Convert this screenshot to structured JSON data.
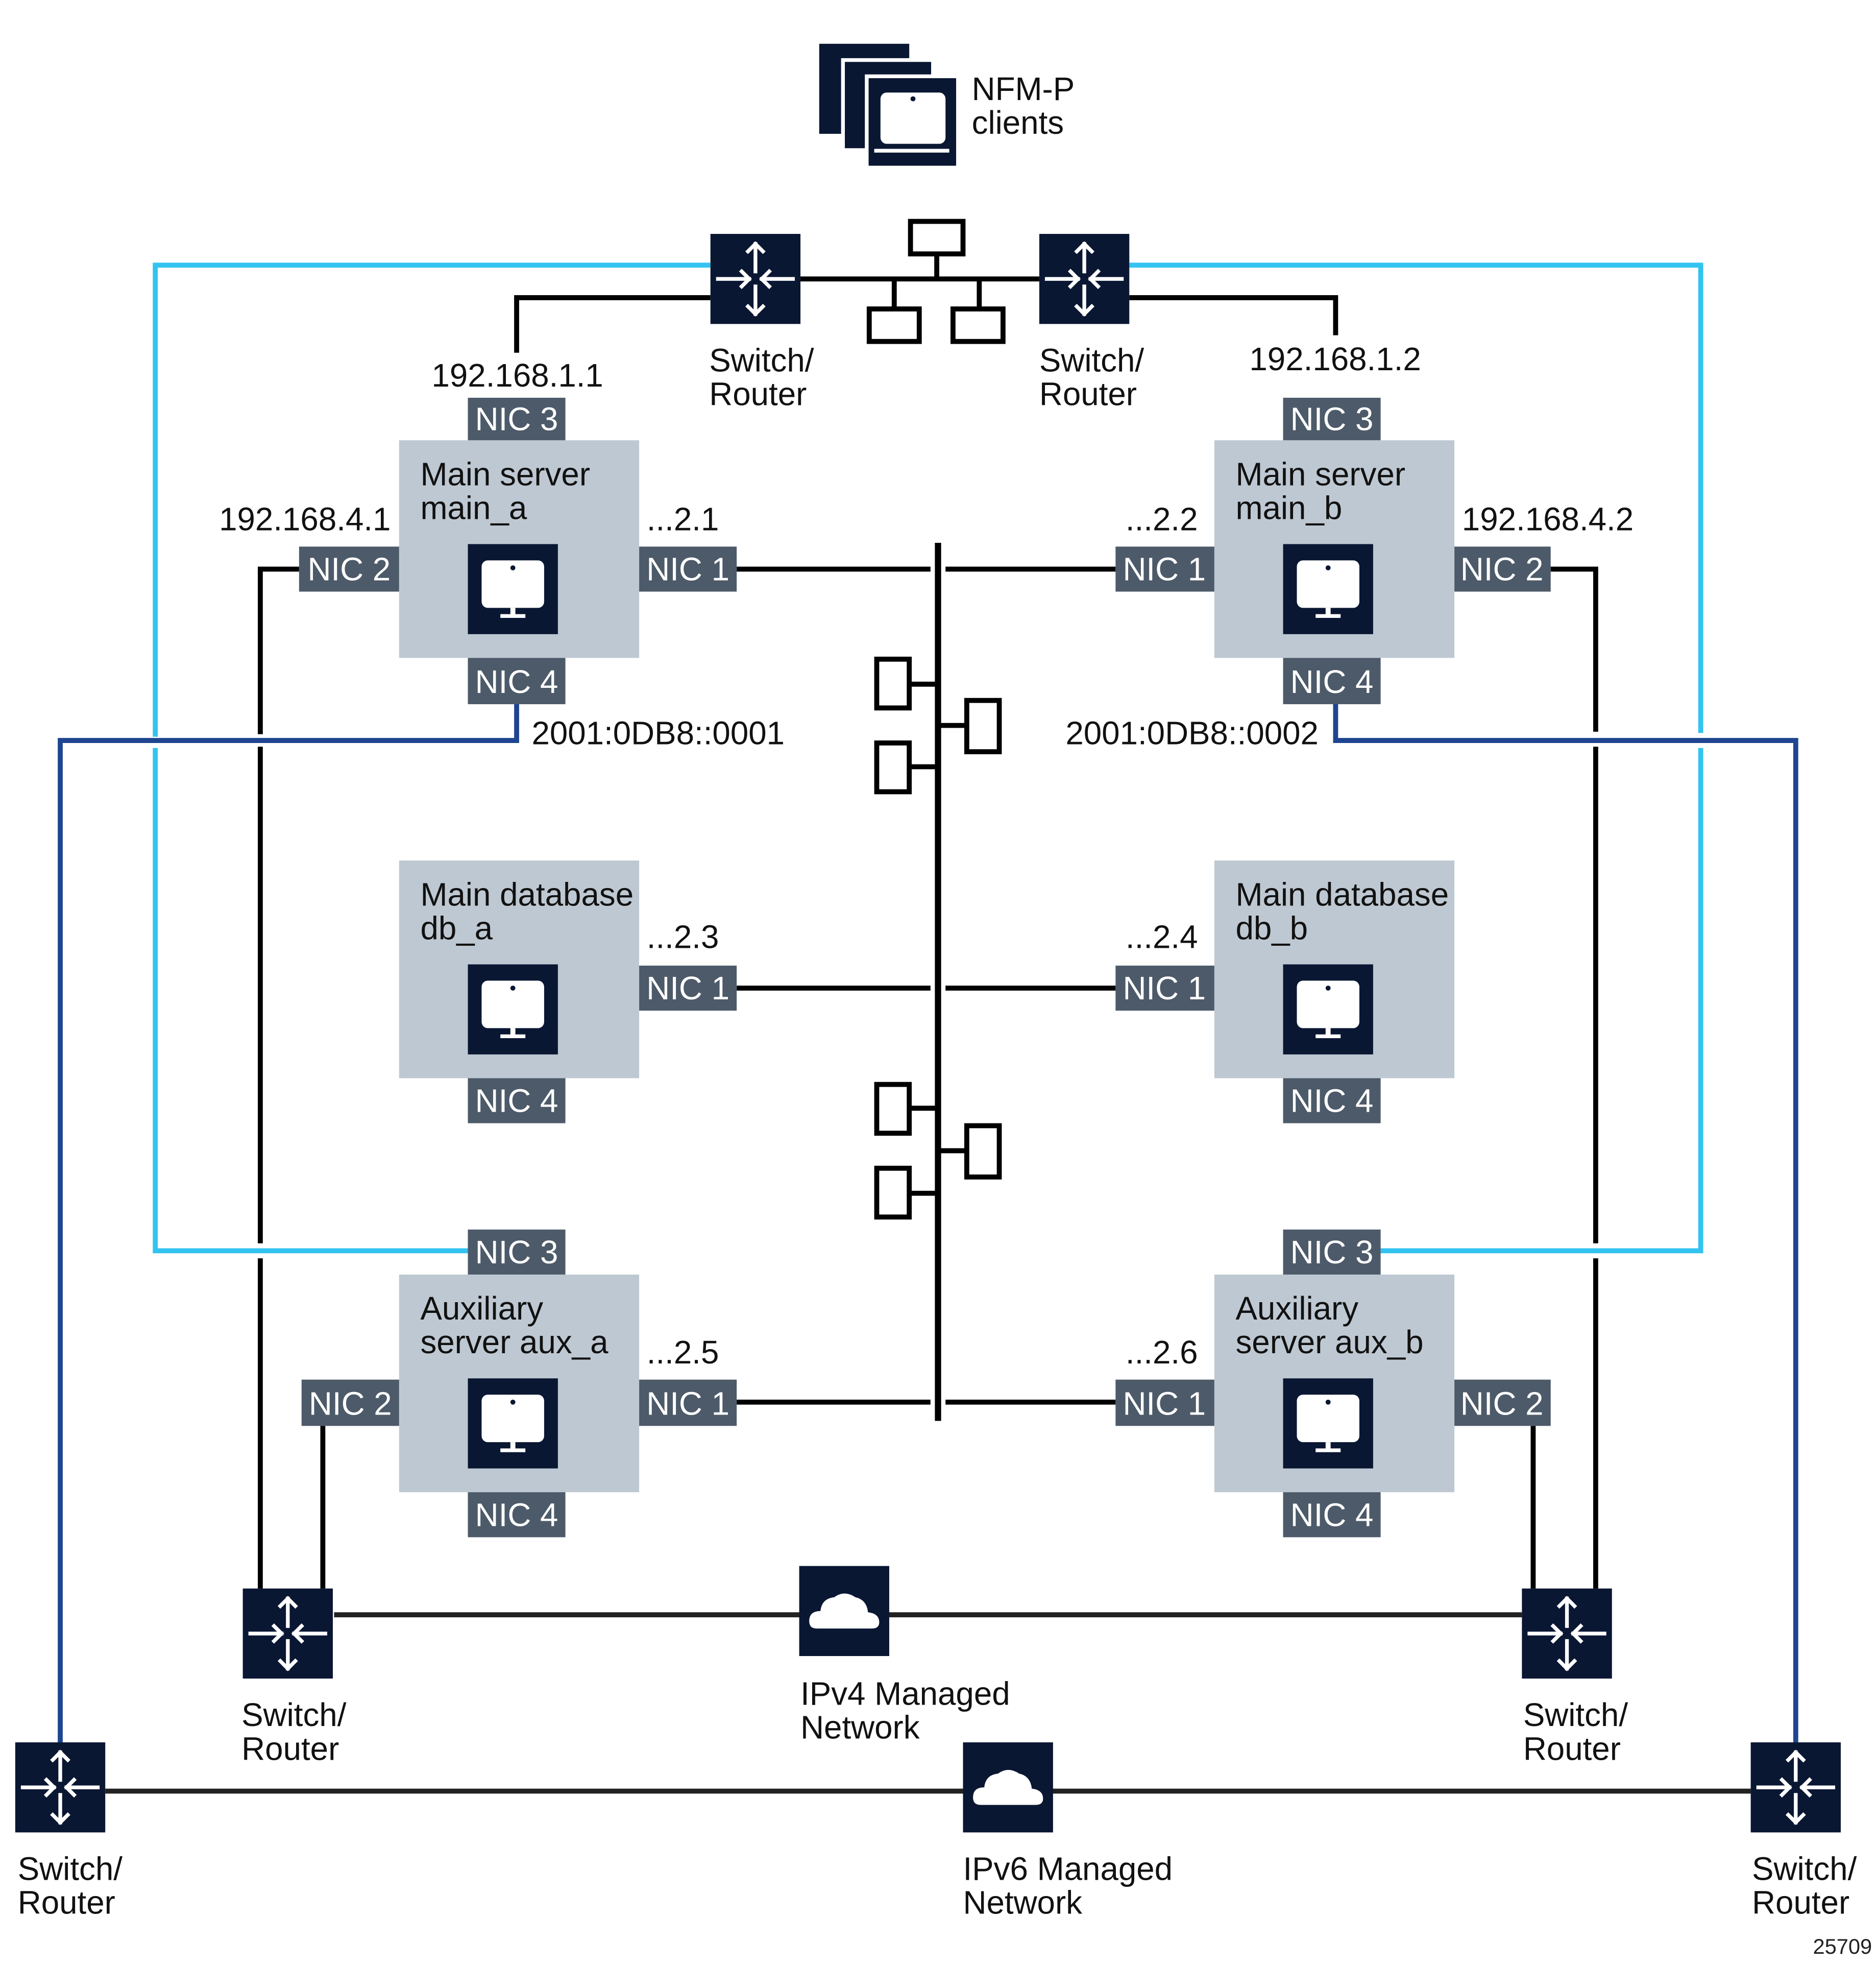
{
  "colors": {
    "navy": "#0a1733",
    "server_box": "#bec8d2",
    "nic": "#4d5a69",
    "link_black": "#000000",
    "link_cyan": "#33c3f0",
    "link_blue": "#1f4590",
    "managed_link": "#222222"
  },
  "clients": {
    "line1": "NFM-P",
    "line2": "clients"
  },
  "switch_label": {
    "line1": "Switch/",
    "line2": "Router"
  },
  "servers": {
    "main_a": {
      "line1": "Main server",
      "line2": "main_a",
      "nic1_addr": "...2.1",
      "nic2_addr": "192.168.4.1",
      "nic3_addr": "192.168.1.1",
      "nic4_addr": "2001:0DB8::0001"
    },
    "main_b": {
      "line1": "Main server",
      "line2": "main_b",
      "nic1_addr": "...2.2",
      "nic2_addr": "192.168.4.2",
      "nic3_addr": "192.168.1.2",
      "nic4_addr": "2001:0DB8::0002"
    },
    "db_a": {
      "line1": "Main database",
      "line2": "db_a",
      "nic1_addr": "...2.3"
    },
    "db_b": {
      "line1": "Main database",
      "line2": "db_b",
      "nic1_addr": "...2.4"
    },
    "aux_a": {
      "line1": "Auxiliary",
      "line2": "server aux_a",
      "nic1_addr": "...2.5"
    },
    "aux_b": {
      "line1": "Auxiliary",
      "line2": "server aux_b",
      "nic1_addr": "...2.6"
    }
  },
  "nics": {
    "nic1": "NIC 1",
    "nic2": "NIC 2",
    "nic3": "NIC 3",
    "nic4": "NIC 4"
  },
  "networks": {
    "ipv4": {
      "line1": "IPv4 Managed",
      "line2": "Network"
    },
    "ipv6": {
      "line1": "IPv6 Managed",
      "line2": "Network"
    }
  },
  "figure_number": "25709"
}
